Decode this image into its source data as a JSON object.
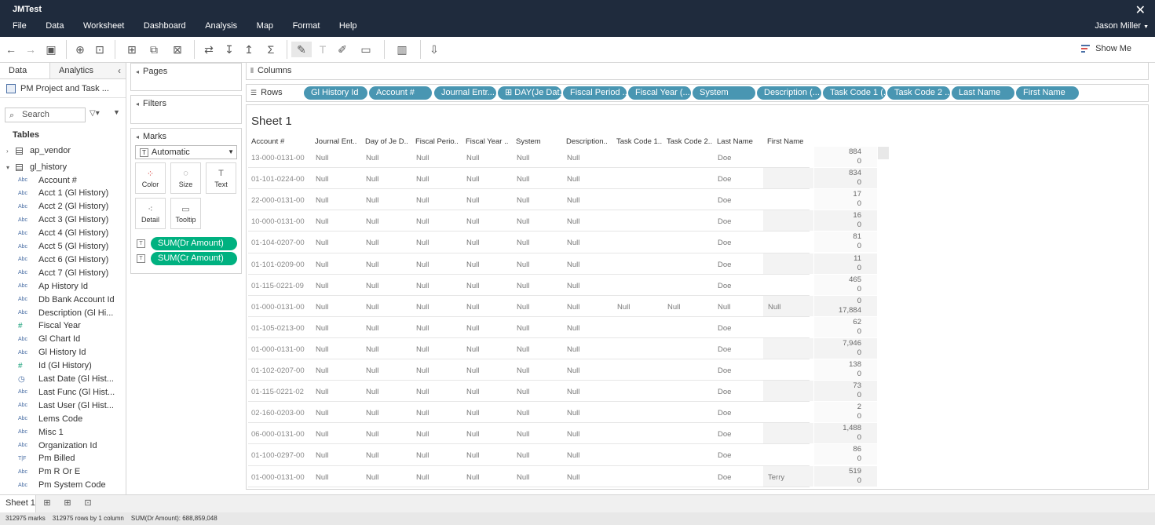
{
  "app": {
    "title": "JMTest",
    "close_glyph": "✕"
  },
  "menu": [
    "File",
    "Data",
    "Worksheet",
    "Dashboard",
    "Analysis",
    "Map",
    "Format",
    "Help"
  ],
  "user": {
    "name": "Jason Miller"
  },
  "toolbar": {
    "show_me_label": "Show Me"
  },
  "data_pane": {
    "tab_data": "Data",
    "tab_analytics": "Analytics",
    "datasource": "PM Project and Task ...",
    "search_placeholder": "Search",
    "tables_header": "Tables",
    "tables": [
      {
        "name": "ap_vendor",
        "expanded": false
      },
      {
        "name": "gl_history",
        "expanded": true
      }
    ],
    "fields": [
      {
        "type": "Abc",
        "name": "Account #"
      },
      {
        "type": "Abc",
        "name": "Acct 1 (Gl History)"
      },
      {
        "type": "Abc",
        "name": "Acct 2 (Gl History)"
      },
      {
        "type": "Abc",
        "name": "Acct 3 (Gl History)"
      },
      {
        "type": "Abc",
        "name": "Acct 4 (Gl History)"
      },
      {
        "type": "Abc",
        "name": "Acct 5 (Gl History)"
      },
      {
        "type": "Abc",
        "name": "Acct 6 (Gl History)"
      },
      {
        "type": "Abc",
        "name": "Acct 7 (Gl History)"
      },
      {
        "type": "Abc",
        "name": "Ap History Id"
      },
      {
        "type": "Abc",
        "name": "Db Bank Account Id"
      },
      {
        "type": "Abc",
        "name": "Description (Gl Hi..."
      },
      {
        "type": "#",
        "name": "Fiscal Year"
      },
      {
        "type": "Abc",
        "name": "Gl Chart Id"
      },
      {
        "type": "Abc",
        "name": "Gl History Id"
      },
      {
        "type": "#",
        "name": "Id (Gl History)"
      },
      {
        "type": "date",
        "name": "Last Date (Gl Hist..."
      },
      {
        "type": "Abc",
        "name": "Last Func (Gl Hist..."
      },
      {
        "type": "Abc",
        "name": "Last User (Gl Hist..."
      },
      {
        "type": "Abc",
        "name": "Lems Code"
      },
      {
        "type": "Abc",
        "name": "Misc 1"
      },
      {
        "type": "Abc",
        "name": "Organization Id"
      },
      {
        "type": "T|F",
        "name": "Pm Billed"
      },
      {
        "type": "Abc",
        "name": "Pm R Or E"
      },
      {
        "type": "Abc",
        "name": "Pm System Code"
      }
    ]
  },
  "cards": {
    "pages": "Pages",
    "filters": "Filters",
    "marks": "Marks",
    "mark_type": "Automatic",
    "mark_buttons": {
      "color": "Color",
      "size": "Size",
      "text": "Text",
      "detail": "Detail",
      "tooltip": "Tooltip"
    },
    "measure_pills": [
      "SUM(Dr Amount)",
      "SUM(Cr Amount)"
    ]
  },
  "shelves": {
    "columns_label": "Columns",
    "rows_label": "Rows",
    "row_pills": [
      "Gl History Id",
      "Account #",
      "Journal Entr...",
      "⊞ DAY(Je Dat...",
      "Fiscal Period ...",
      "Fiscal Year (...",
      "System",
      "Description (...",
      "Task Code 1 (...",
      "Task Code 2 ...",
      "Last Name",
      "First Name"
    ]
  },
  "view": {
    "sheet_title": "Sheet 1",
    "headers": [
      "Account #",
      "Journal Ent..",
      "Day of Je D..",
      "Fiscal Perio..",
      "Fiscal Year ..",
      "System",
      "Description..",
      "Task Code 1..",
      "Task Code 2..",
      "Last Name",
      "First Name"
    ],
    "rows": [
      {
        "acct": "13-000-0131-00",
        "cols": [
          "Null",
          "Null",
          "Null",
          "Null",
          "Null",
          "Null",
          "",
          "",
          "Doe",
          ""
        ],
        "vals": [
          "884",
          "0"
        ],
        "shade": false
      },
      {
        "acct": "01-101-0224-00",
        "cols": [
          "Null",
          "Null",
          "Null",
          "Null",
          "Null",
          "Null",
          "",
          "",
          "Doe",
          ""
        ],
        "vals": [
          "834",
          "0"
        ],
        "shade": true
      },
      {
        "acct": "22-000-0131-00",
        "cols": [
          "Null",
          "Null",
          "Null",
          "Null",
          "Null",
          "Null",
          "",
          "",
          "Doe",
          ""
        ],
        "vals": [
          "17",
          "0"
        ],
        "shade": false
      },
      {
        "acct": "10-000-0131-00",
        "cols": [
          "Null",
          "Null",
          "Null",
          "Null",
          "Null",
          "Null",
          "",
          "",
          "Doe",
          ""
        ],
        "vals": [
          "16",
          "0"
        ],
        "shade": true
      },
      {
        "acct": "01-104-0207-00",
        "cols": [
          "Null",
          "Null",
          "Null",
          "Null",
          "Null",
          "Null",
          "",
          "",
          "Doe",
          ""
        ],
        "vals": [
          "81",
          "0"
        ],
        "shade": false
      },
      {
        "acct": "01-101-0209-00",
        "cols": [
          "Null",
          "Null",
          "Null",
          "Null",
          "Null",
          "Null",
          "",
          "",
          "Doe",
          ""
        ],
        "vals": [
          "11",
          "0"
        ],
        "shade": true
      },
      {
        "acct": "01-115-0221-09",
        "cols": [
          "Null",
          "Null",
          "Null",
          "Null",
          "Null",
          "Null",
          "",
          "",
          "Doe",
          ""
        ],
        "vals": [
          "465",
          "0"
        ],
        "shade": false
      },
      {
        "acct": "01-000-0131-00",
        "cols": [
          "Null",
          "Null",
          "Null",
          "Null",
          "Null",
          "Null",
          "Null",
          "Null",
          "Null",
          "Null"
        ],
        "vals": [
          "0",
          "17,884"
        ],
        "shade": true
      },
      {
        "acct": "01-105-0213-00",
        "cols": [
          "Null",
          "Null",
          "Null",
          "Null",
          "Null",
          "Null",
          "",
          "",
          "Doe",
          ""
        ],
        "vals": [
          "62",
          "0"
        ],
        "shade": false
      },
      {
        "acct": "01-000-0131-00",
        "cols": [
          "Null",
          "Null",
          "Null",
          "Null",
          "Null",
          "Null",
          "",
          "",
          "Doe",
          ""
        ],
        "vals": [
          "7,946",
          "0"
        ],
        "shade": true
      },
      {
        "acct": "01-102-0207-00",
        "cols": [
          "Null",
          "Null",
          "Null",
          "Null",
          "Null",
          "Null",
          "",
          "",
          "Doe",
          ""
        ],
        "vals": [
          "138",
          "0"
        ],
        "shade": false
      },
      {
        "acct": "01-115-0221-02",
        "cols": [
          "Null",
          "Null",
          "Null",
          "Null",
          "Null",
          "Null",
          "",
          "",
          "Doe",
          ""
        ],
        "vals": [
          "73",
          "0"
        ],
        "shade": true
      },
      {
        "acct": "02-160-0203-00",
        "cols": [
          "Null",
          "Null",
          "Null",
          "Null",
          "Null",
          "Null",
          "",
          "",
          "Doe",
          ""
        ],
        "vals": [
          "2",
          "0"
        ],
        "shade": false
      },
      {
        "acct": "06-000-0131-00",
        "cols": [
          "Null",
          "Null",
          "Null",
          "Null",
          "Null",
          "Null",
          "",
          "",
          "Doe",
          ""
        ],
        "vals": [
          "1,488",
          "0"
        ],
        "shade": true
      },
      {
        "acct": "01-100-0297-00",
        "cols": [
          "Null",
          "Null",
          "Null",
          "Null",
          "Null",
          "Null",
          "",
          "",
          "Doe",
          ""
        ],
        "vals": [
          "86",
          "0"
        ],
        "shade": false
      },
      {
        "acct": "01-000-0131-00",
        "cols": [
          "Null",
          "Null",
          "Null",
          "Null",
          "Null",
          "Null",
          "",
          "",
          "Doe",
          "Terry"
        ],
        "vals": [
          "519",
          "0"
        ],
        "shade": true
      }
    ]
  },
  "bottom": {
    "sheet_tab": "Sheet 1",
    "status": [
      "312975 marks",
      "312975 rows by 1 column",
      "SUM(Dr Amount): 688,859,048"
    ]
  },
  "colors": {
    "titlebar": "#1f2b3d",
    "green_pill": "#00b180",
    "blue_pill": "#4996b2"
  }
}
